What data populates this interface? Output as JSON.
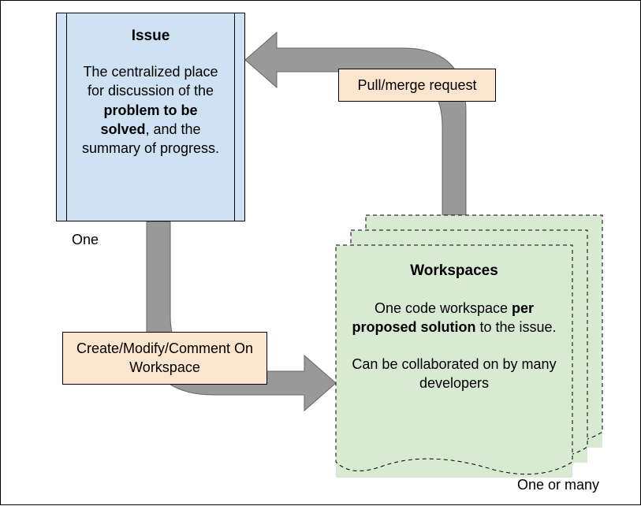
{
  "issue": {
    "title": "Issue",
    "desc_pre": "The centralized place for discussion of the ",
    "desc_bold": "problem to be solved",
    "desc_post": ", and the summary of progress.",
    "multiplicity": "One"
  },
  "workspaces": {
    "title": "Workspaces",
    "desc1_pre": "One code workspace ",
    "desc1_bold": "per proposed solution",
    "desc1_post": " to the issue.",
    "desc2": "Can be collaborated on by many developers",
    "multiplicity": "One or many"
  },
  "arrows": {
    "to_issue_label": "Pull/merge request",
    "to_workspace_label": "Create/Modify/Comment On Workspace"
  },
  "colors": {
    "issue_bg": "#cfe2f3",
    "workspace_bg": "#d9ead3",
    "label_bg": "#fce5cd",
    "arrow": "#999999"
  },
  "chart_data": {
    "type": "diagram",
    "title": "Issue and Workspaces relationship",
    "nodes": [
      {
        "id": "issue",
        "label": "Issue",
        "multiplicity": "One",
        "description": "The centralized place for discussion of the problem to be solved, and the summary of progress."
      },
      {
        "id": "workspaces",
        "label": "Workspaces",
        "multiplicity": "One or many",
        "description": "One code workspace per proposed solution to the issue. Can be collaborated on by many developers"
      }
    ],
    "edges": [
      {
        "from": "issue",
        "to": "workspaces",
        "label": "Create/Modify/Comment On Workspace"
      },
      {
        "from": "workspaces",
        "to": "issue",
        "label": "Pull/merge request"
      }
    ]
  }
}
